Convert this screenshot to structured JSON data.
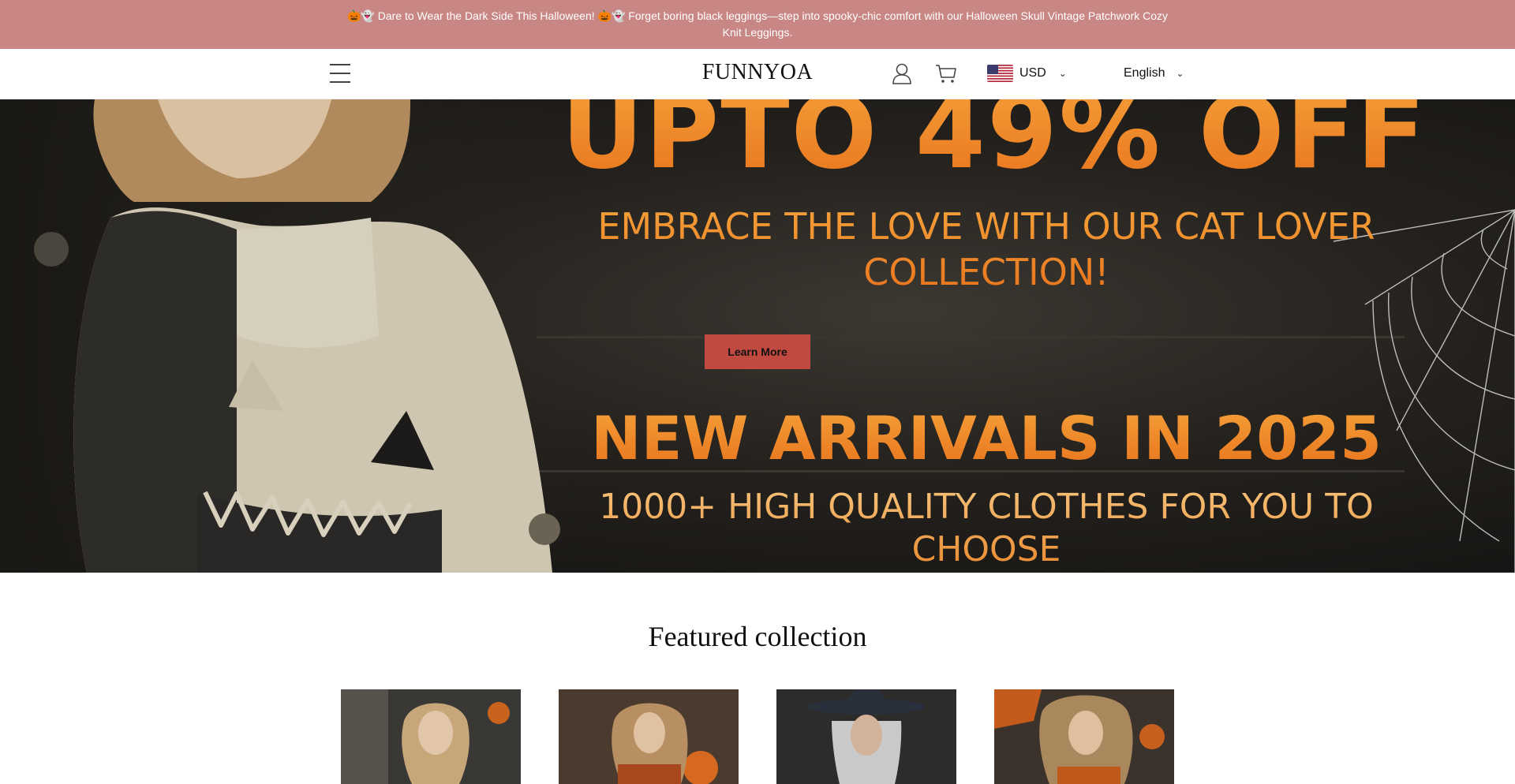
{
  "announcement": {
    "text": "🎃👻 Dare to Wear the Dark Side This Halloween! 🎃👻 Forget boring black leggings—step into spooky-chic comfort with our Halloween Skull Vintage Patchwork Cozy Knit Leggings."
  },
  "header": {
    "logo": "FUNNYOA",
    "currency": "USD",
    "language": "English",
    "icons": [
      "menu-icon",
      "user-icon",
      "cart-icon",
      "us-flag-icon",
      "chevron-down-icon"
    ]
  },
  "hero": {
    "headline": "UPTO 49% OFF",
    "subline": "EMBRACE THE LOVE WITH OUR CAT LOVER COLLECTION!",
    "button": "Learn More",
    "arrivals": "NEW ARRIVALS IN 2025",
    "choose": "1000+ HIGH QUALITY CLOTHES FOR YOU TO CHOOSE"
  },
  "featured": {
    "title": "Featured collection",
    "cards": [
      {
        "name": "product-card-1"
      },
      {
        "name": "product-card-2"
      },
      {
        "name": "product-card-3"
      },
      {
        "name": "product-card-4"
      }
    ]
  },
  "colors": {
    "announcement_bg": "#c88784",
    "accent_orange": "#f5a13a",
    "button_red": "#c14a40"
  }
}
